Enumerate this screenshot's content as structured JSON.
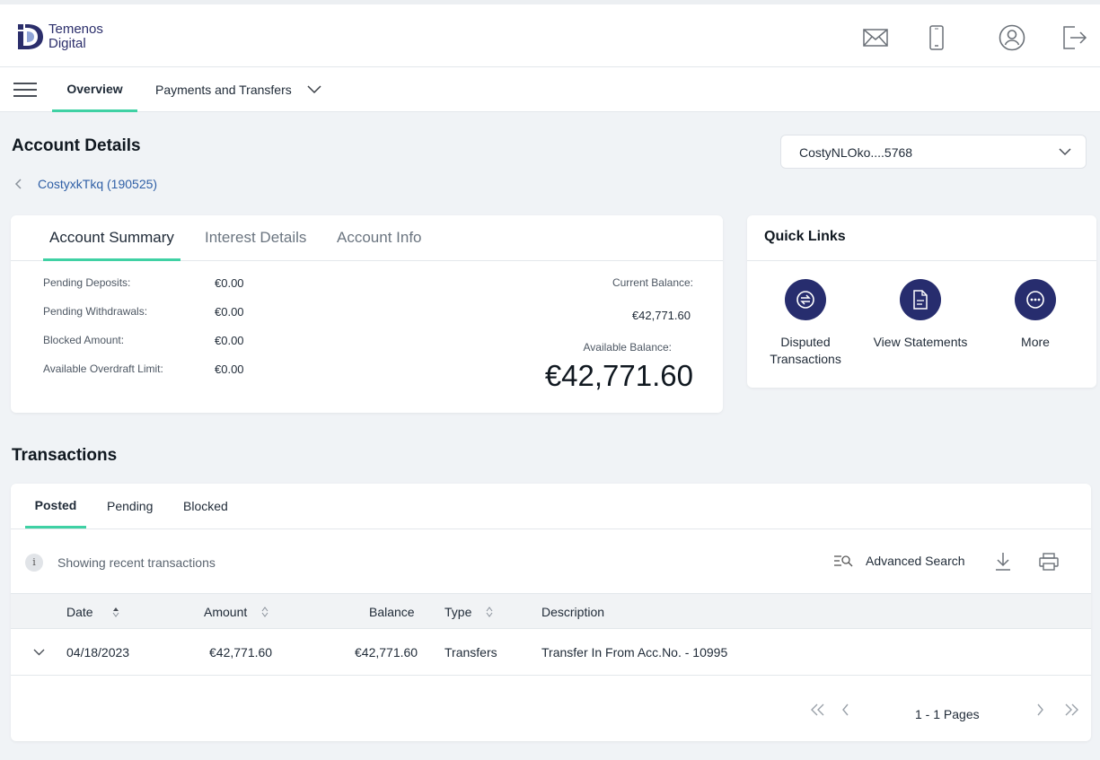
{
  "brand": {
    "line1": "Temenos",
    "line2": "Digital",
    "accent": "#3fd1a4",
    "primary": "#272d6e"
  },
  "header": {
    "icons": [
      "mail-icon",
      "mobile-icon",
      "profile-icon",
      "logout-icon"
    ]
  },
  "nav": {
    "tabs": [
      {
        "label": "Overview",
        "active": true
      },
      {
        "label": "Payments and Transfers",
        "active": false
      }
    ]
  },
  "page": {
    "title": "Account Details",
    "breadcrumb": "CostyxkTkq (190525)",
    "account_selector": "CostyNLOko....5768"
  },
  "summary": {
    "tabs": [
      "Account Summary",
      "Interest Details",
      "Account Info"
    ],
    "rows": [
      {
        "label": "Pending Deposits:",
        "value": "€0.00"
      },
      {
        "label": "Pending Withdrawals:",
        "value": "€0.00"
      },
      {
        "label": "Blocked Amount:",
        "value": "€0.00"
      },
      {
        "label": "Available Overdraft Limit:",
        "value": "€0.00"
      }
    ],
    "current_balance_label": "Current Balance:",
    "current_balance": "€42,771.60",
    "available_balance_label": "Available Balance:",
    "available_balance": "€42,771.60"
  },
  "quick_links": {
    "title": "Quick Links",
    "items": [
      {
        "label": "Disputed Transactions",
        "icon": "dispute-icon"
      },
      {
        "label": "View Statements",
        "icon": "document-icon"
      },
      {
        "label": "More",
        "icon": "more-icon"
      }
    ]
  },
  "transactions": {
    "title": "Transactions",
    "tabs": [
      "Posted",
      "Pending",
      "Blocked"
    ],
    "info": "Showing recent transactions",
    "advanced_search": "Advanced Search",
    "columns": [
      "Date",
      "Amount",
      "Balance",
      "Type",
      "Description"
    ],
    "rows": [
      {
        "date": "04/18/2023",
        "amount": "€42,771.60",
        "balance": "€42,771.60",
        "type": "Transfers",
        "description": "Transfer In From Acc.No. - 10995"
      }
    ],
    "pages": "1 - 1 Pages"
  }
}
